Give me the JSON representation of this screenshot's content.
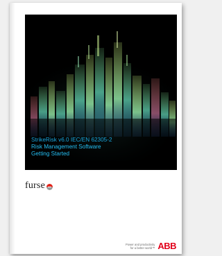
{
  "cover": {
    "title_line1": "StrikeRisk v6.0 IEC/EN 62305-2",
    "title_line2": "Risk Management Software",
    "title_line3": "Getting Started"
  },
  "brand": {
    "furse_wordmark": "furse",
    "abb_tagline_line1": "Power and productivity",
    "abb_tagline_line2": "for a better world™",
    "abb_logo": "ABB"
  },
  "colors": {
    "title_blue": "#19a7e0",
    "abb_red": "#e2001a",
    "furse_red": "#e2231a",
    "cover_black": "#000000"
  }
}
